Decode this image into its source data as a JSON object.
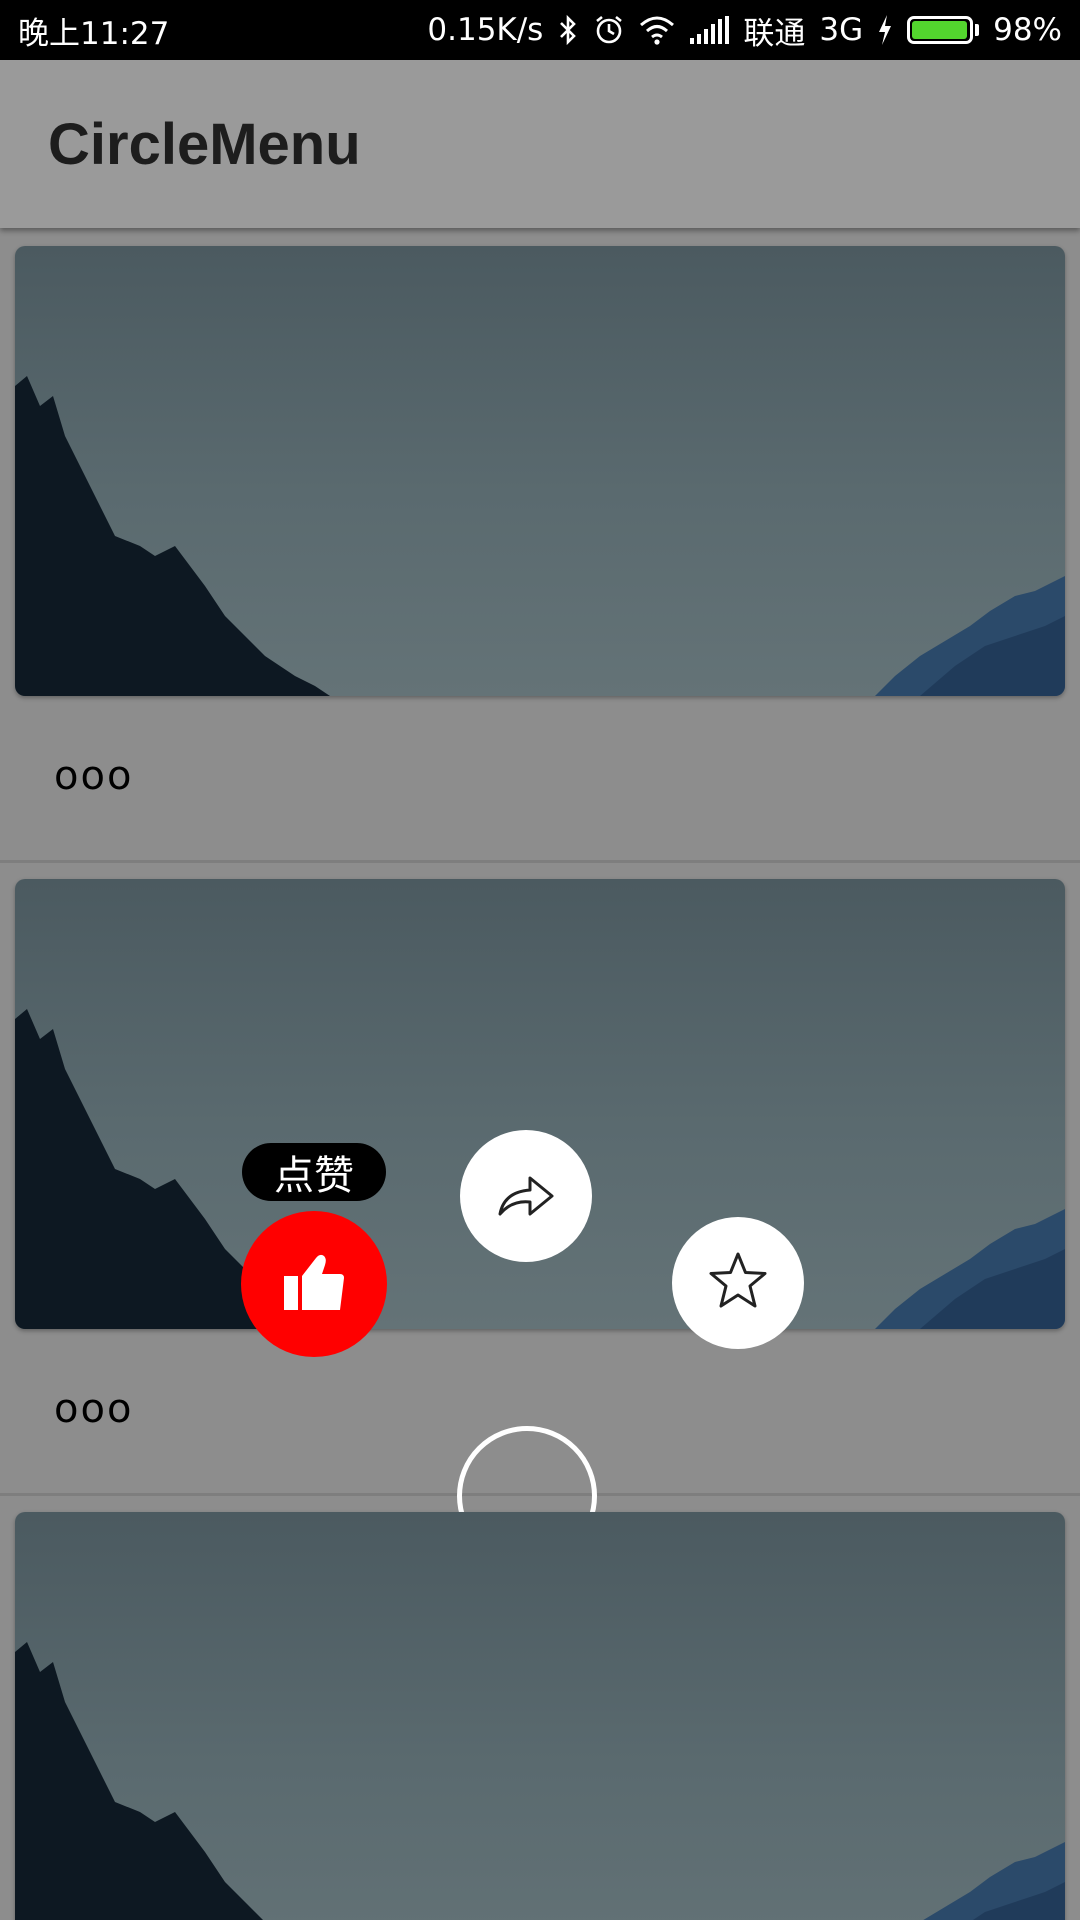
{
  "status_bar": {
    "time": "晚上11:27",
    "speed": "0.15K/s",
    "carrier": "联通",
    "network": "3G",
    "battery": "98%",
    "battery_level": 0.98,
    "battery_color": "#53d62e",
    "icons": [
      "bluetooth-icon",
      "alarm-icon",
      "wifi-icon",
      "signal-icon",
      "charging-icon",
      "battery-icon"
    ]
  },
  "app_bar": {
    "title": "CircleMenu"
  },
  "feed": {
    "cards": [
      {
        "image": "mountain-landscape",
        "meta": "ooo"
      },
      {
        "image": "mountain-landscape",
        "meta": "ooo"
      },
      {
        "image": "mountain-landscape",
        "meta": ""
      }
    ]
  },
  "circle_menu": {
    "tooltip": "点赞",
    "items": [
      {
        "name": "like",
        "icon": "thumbs-up-icon",
        "color": "#ff0000",
        "active": true
      },
      {
        "name": "share",
        "icon": "share-icon",
        "color": "#ffffff"
      },
      {
        "name": "favorite",
        "icon": "star-icon",
        "color": "#ffffff"
      }
    ],
    "center": "circle-outline"
  }
}
